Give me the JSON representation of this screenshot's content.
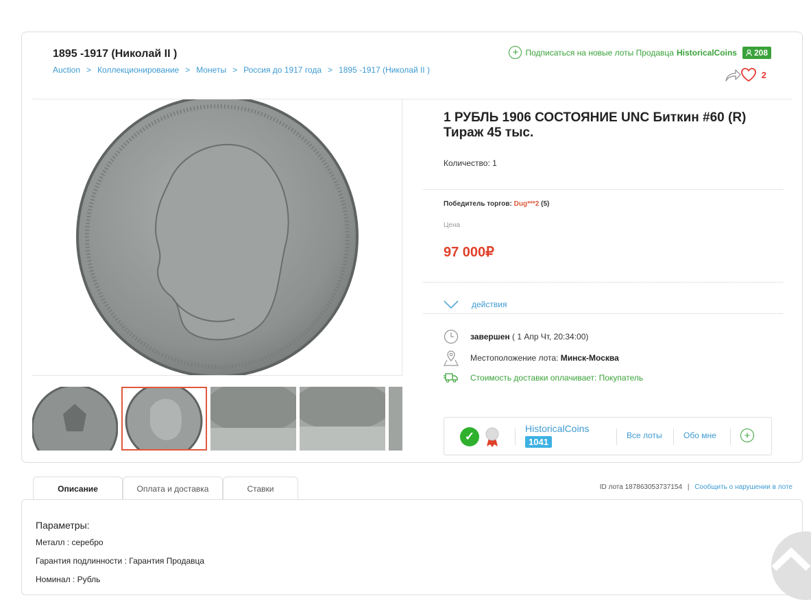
{
  "header": {
    "category_title": "1895 -1917 (Николай II )",
    "breadcrumbs": [
      "Auction",
      "Коллекционирование",
      "Монеты",
      "Россия до 1917 года",
      "1895 -1917 (Николай II )"
    ],
    "breadcrumb_sep": ">",
    "subscribe_text": "Подписаться на новые лоты Продавца",
    "seller_name": "HistoricalCoins",
    "subscribers_count": "208",
    "favorites_count": "2"
  },
  "lot": {
    "title": "1 РУБЛЬ 1906 СОСТОЯНИЕ UNC Биткин #60 (R) Тираж 45 тыс.",
    "quantity_label": "Количество: 1",
    "winner_label": "Победитель торгов:",
    "winner_nick": "Dug***2",
    "winner_rating": "(5)",
    "price_label": "Цена",
    "price": "97 000₽",
    "actions_label": "действия",
    "status_bold": "завершен",
    "status_date": "( 1 Апр Чт, 20:34:00)",
    "location_label": "Местоположение лота:",
    "location_value": "Минск-Москва",
    "delivery_text": "Стоимость доставки оплачивает: Покупатель"
  },
  "seller_box": {
    "name": "HistoricalCoins",
    "lots_count": "1041",
    "all_lots": "Все лоты",
    "about": "Обо мне"
  },
  "tabs": [
    "Описание",
    "Оплата и доставка",
    "Ставки"
  ],
  "lot_id_text": "ID лота 187863053737154",
  "id_sep": "|",
  "report_link": "Сообщить о нарушении в лоте",
  "description": {
    "heading": "Параметры:",
    "params": [
      "Металл : серебро",
      "Гарантия подлинности : Гарантия Продавца",
      "Номинал : Рубль"
    ]
  },
  "colors": {
    "accent_green": "#3aa23a",
    "link_blue": "#3d9ad1",
    "price_red": "#e0402a"
  },
  "icons": [
    "plus-circle-icon",
    "user-icon",
    "share-icon",
    "heart-icon",
    "chevron-down-icon",
    "clock-icon",
    "map-pin-icon",
    "truck-icon",
    "check-icon",
    "medal-icon",
    "scroll-up-icon"
  ]
}
